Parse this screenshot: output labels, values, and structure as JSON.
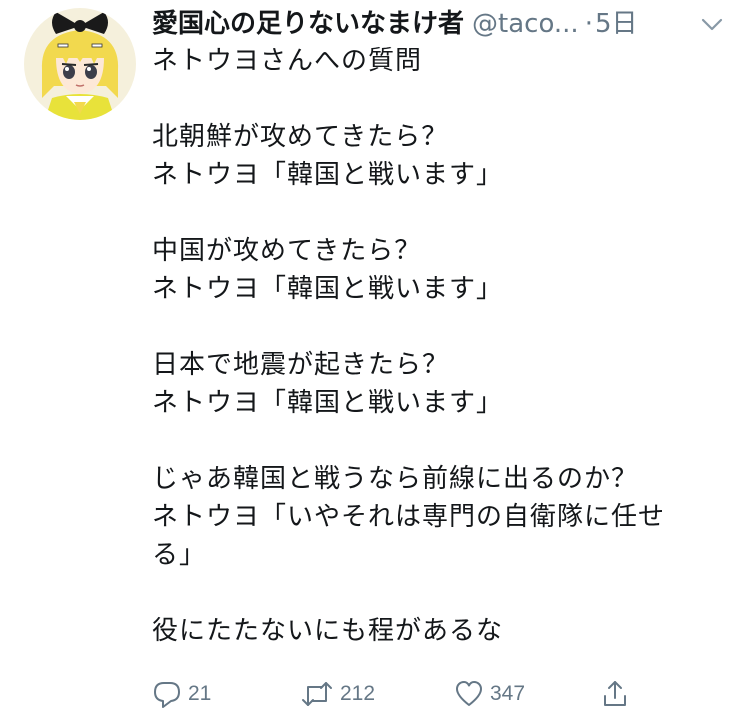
{
  "header": {
    "display_name": "愛国心の足りないなまけ者",
    "handle": "@taco...",
    "separator": "·",
    "time": "5日"
  },
  "tweet": {
    "lines": [
      "ネトウヨさんへの質問",
      "",
      "北朝鮮が攻めてきたら？",
      "ネトウヨ「韓国と戦います」",
      "",
      "中国が攻めてきたら？",
      "ネトウヨ「韓国と戦います」",
      "",
      "日本で地震が起きたら？",
      "ネトウヨ「韓国と戦います」",
      "",
      "じゃあ韓国と戦うなら前線に出るのか？",
      "ネトウヨ「いやそれは専門の自衛隊に任せ",
      "る」",
      "",
      "役にたたないにも程があるな"
    ]
  },
  "actions": {
    "reply": {
      "icon": "reply-icon",
      "count": "21"
    },
    "retweet": {
      "icon": "retweet-icon",
      "count": "212"
    },
    "like": {
      "icon": "heart-icon",
      "count": "347"
    },
    "share": {
      "icon": "share-icon"
    }
  },
  "colors": {
    "text": "#14171a",
    "secondary": "#657786",
    "avatar_hair": "#f2d94e",
    "avatar_bow": "#1a1a1a",
    "avatar_background": "#f5f0dc"
  }
}
